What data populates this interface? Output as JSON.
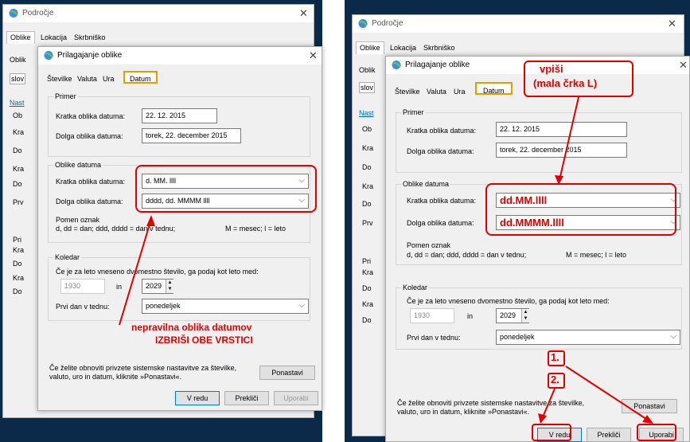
{
  "left": {
    "outer_title": "Področje",
    "outer_tabs": [
      "Oblike",
      "Lokacija",
      "Skrbniško"
    ],
    "outer_side_texts": [
      "Oblik",
      "slov",
      "Nast",
      "Ob",
      "Kra",
      "Do",
      "Kra",
      "Do",
      "Prv",
      "Pri",
      "Kra",
      "Do",
      "Kra",
      "Do"
    ],
    "dialog_title": "Prilagajanje oblike",
    "tabs": [
      "Številke",
      "Valuta",
      "Ura",
      "Datum"
    ],
    "primer_title": "Primer",
    "short_label": "Kratka oblika datuma:",
    "short_value": "22. 12. 2015",
    "long_label": "Dolga oblika datuma:",
    "long_value": "torek, 22. december 2015",
    "formats_title": "Oblike datuma",
    "fmt_short_label": "Kratka oblika datuma:",
    "fmt_short_value": "d. MM. llll",
    "fmt_long_label": "Dolga oblika datuma:",
    "fmt_long_value": "dddd, dd. MMMM llll",
    "legend_title": "Pomen oznak",
    "legend_line": "d, dd = dan; ddd, dddd = dan v tednu;",
    "legend_right": "M = mesec;   l = leto",
    "calendar_title": "Koledar",
    "calendar_text": "Če je za leto vneseno dvomestno število, ga podaj kot leto med:",
    "year_from": "1930",
    "year_in": "in",
    "year_to": "2029",
    "first_day_label": "Prvi dan v tednu:",
    "first_day_value": "ponedeljek",
    "reset_text": "Če želite obnoviti privzete sistemske nastavitve za številke, valuto, uro in datum, kliknite »Ponastavi«.",
    "reset_button": "Ponastavi",
    "ok": "V redu",
    "cancel": "Prekliči",
    "apply": "Uporabi",
    "annotation_line1": "nepravilna oblika datumov",
    "annotation_line2": "IZBRIŠI OBE VRSTICI"
  },
  "right": {
    "outer_title": "Področje",
    "outer_tabs": [
      "Oblike",
      "Lokacija",
      "Skrbniško"
    ],
    "outer_side_texts": [
      "Oblik",
      "slov",
      "Nast",
      "Ob",
      "Kra",
      "Do",
      "Kra",
      "Do",
      "Prv",
      "Pri",
      "Kra",
      "Do",
      "Kra",
      "Do"
    ],
    "dialog_title": "Prilagajanje oblike",
    "tabs": [
      "Številke",
      "Valuta",
      "Ura",
      "Datum"
    ],
    "primer_title": "Primer",
    "short_label": "Kratka oblika datuma:",
    "short_value": "22. 12. 2015",
    "long_label": "Dolga oblika datuma:",
    "long_value": "torek, 22. december 2015",
    "formats_title": "Oblike datuma",
    "fmt_short_label": "Kratka oblika datuma:",
    "fmt_short_value": "dd.MM.llll",
    "fmt_long_label": "Dolga oblika datuma:",
    "fmt_long_value": "dd.MMMM.llll",
    "legend_title": "Pomen oznak",
    "legend_line": "d, dd = dan; ddd, dddd = dan v tednu;",
    "legend_right": "M = mesec;   l = leto",
    "calendar_title": "Koledar",
    "calendar_text": "Če je za leto vneseno dvomestno število, ga podaj kot leto med:",
    "year_from": "1930",
    "year_in": "in",
    "year_to": "2029",
    "first_day_label": "Prvi dan v tednu:",
    "first_day_value": "ponedeljek",
    "reset_text": "Če želite obnoviti privzete sistemske nastavitve za številke, valuto, uro in datum, kliknite »Ponastavi«.",
    "reset_button": "Ponastavi",
    "ok": "V redu",
    "cancel": "Prekliči",
    "apply": "Uporabi",
    "annotation_line1": "vpiši",
    "annotation_line2": "(mala črka L)",
    "step1": "1.",
    "step2": "2."
  },
  "colors": {
    "annotation": "#e00000",
    "highlight": "#ffff33",
    "desktop": "#0b2a4a"
  }
}
